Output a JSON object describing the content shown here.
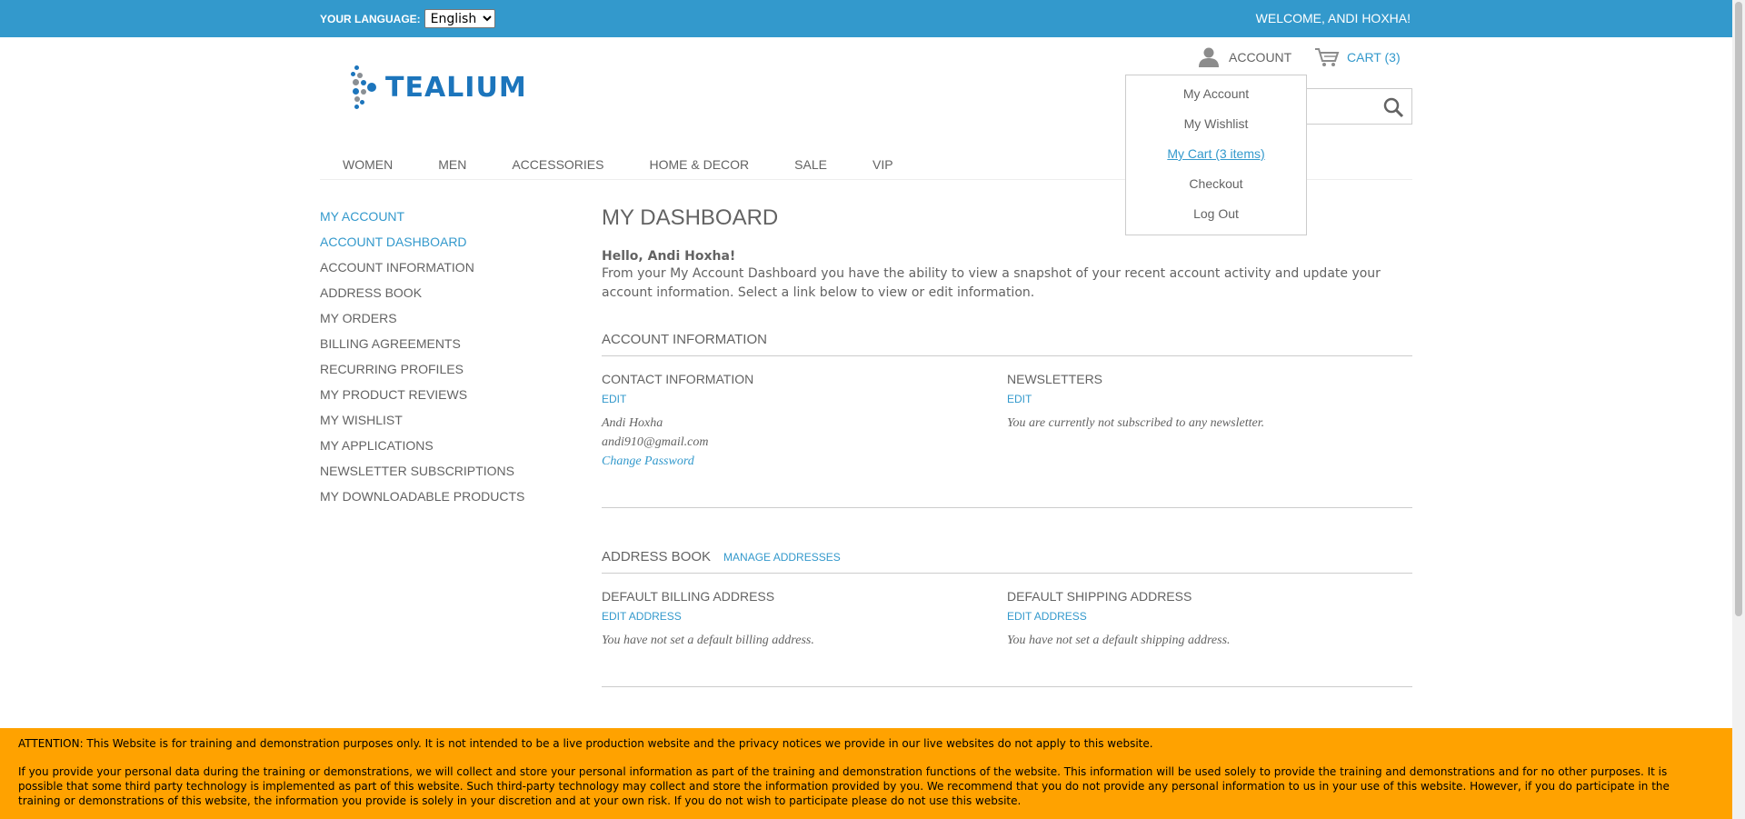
{
  "topbar": {
    "language_label": "Your Language:",
    "language_value": "English",
    "welcome": "Welcome, Andi Hoxha!"
  },
  "header": {
    "logo_text": "TEALIUM",
    "account_label": "Account",
    "cart_label": "Cart (3)",
    "account_menu": [
      "My Account",
      "My Wishlist",
      "My Cart (3 items)",
      "Checkout",
      "Log Out"
    ]
  },
  "nav": [
    "Women",
    "Men",
    "Accessories",
    "Home & Decor",
    "Sale",
    "VIP"
  ],
  "sidebar": {
    "title": "My Account",
    "items": [
      "Account Dashboard",
      "Account Information",
      "Address Book",
      "My Orders",
      "Billing Agreements",
      "Recurring Profiles",
      "My Product Reviews",
      "My Wishlist",
      "My Applications",
      "Newsletter Subscriptions",
      "My Downloadable Products"
    ]
  },
  "main": {
    "title": "My Dashboard",
    "hello": "Hello, Andi Hoxha!",
    "intro": "From your My Account Dashboard you have the ability to view a snapshot of your recent account activity and update your account information. Select a link below to view or edit information.",
    "account_info": {
      "title": "Account Information",
      "contact": {
        "title": "Contact Information",
        "edit": "Edit",
        "name": "Andi Hoxha",
        "email": "andi910@gmail.com",
        "change_password": "Change Password"
      },
      "newsletters": {
        "title": "Newsletters",
        "edit": "Edit",
        "text": "You are currently not subscribed to any newsletter."
      }
    },
    "address_book": {
      "title": "Address Book",
      "manage": "Manage Addresses",
      "billing": {
        "title": "Default Billing Address",
        "edit": "Edit Address",
        "text": "You have not set a default billing address."
      },
      "shipping": {
        "title": "Default Shipping Address",
        "edit": "Edit Address",
        "text": "You have not set a default shipping address."
      }
    }
  },
  "notice": {
    "attention": "ATTENTION: This Website is for training and demonstration purposes only. It is not intended to be a live production website and the privacy notices we provide in our live websites do not apply to this website.",
    "body": "If you provide your personal data during the training or demonstrations, we will collect and store your personal information as part of the training and demonstration functions of the website. This information will be used solely to provide the training and demonstrations and for no other purposes. It is possible that some third party technology is implemented as part of this website. Such third-party technology may collect and store the information provided by you. We recommend that you do not provide any personal information to us in your use of this website. However, if you do participate in the training or demonstrations of this website, the information you provide is solely in your discretion and at your own risk. If you do not wish to participate please do not use this website."
  },
  "colors": {
    "accent": "#3399cc",
    "notice": "#ffa200",
    "text": "#636363"
  }
}
